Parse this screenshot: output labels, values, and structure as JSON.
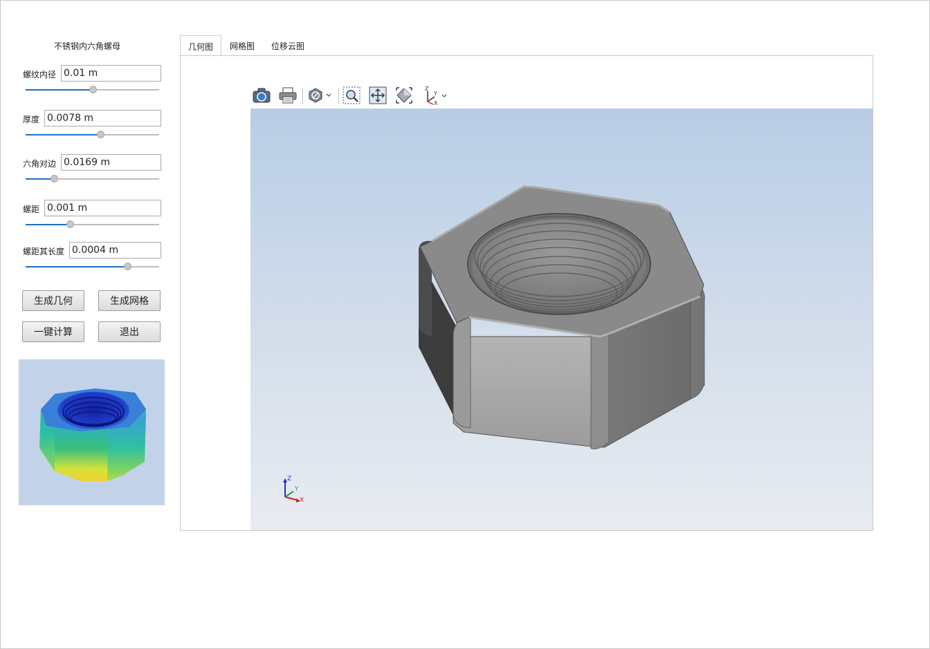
{
  "panel": {
    "title": "不锈钢内六角螺母",
    "params": [
      {
        "label": "螺纹内径",
        "value": "0.01 m",
        "slider": 0.5
      },
      {
        "label": "厚度",
        "value": "0.0078 m",
        "slider": 0.56
      },
      {
        "label": "六角对边",
        "value": "0.0169 m",
        "slider": 0.21
      },
      {
        "label": "螺距",
        "value": "0.001 m",
        "slider": 0.33
      },
      {
        "label": "螺距其长度",
        "value": "0.0004 m",
        "slider": 0.76
      }
    ],
    "buttons": {
      "gen_geometry": "生成几何",
      "gen_mesh": "生成网格",
      "compute": "一键计算",
      "exit": "退出"
    }
  },
  "tabs": [
    {
      "label": "几何图",
      "active": true
    },
    {
      "label": "网格图",
      "active": false
    },
    {
      "label": "位移云图",
      "active": false
    }
  ],
  "toolbar": {
    "icons": [
      "camera-icon",
      "print-icon",
      "display-mode-icon",
      "zoom-box-icon",
      "fit-all-icon",
      "view-cube-icon",
      "axis-view-icon"
    ]
  },
  "triad": {
    "x": "X",
    "y": "Y",
    "z": "Z"
  },
  "colors": {
    "accent": "#1e6fbf",
    "viewport_top": "#b8cde6",
    "viewport_bottom": "#e8ecf1",
    "nut_gray": "#8a8a8a"
  }
}
